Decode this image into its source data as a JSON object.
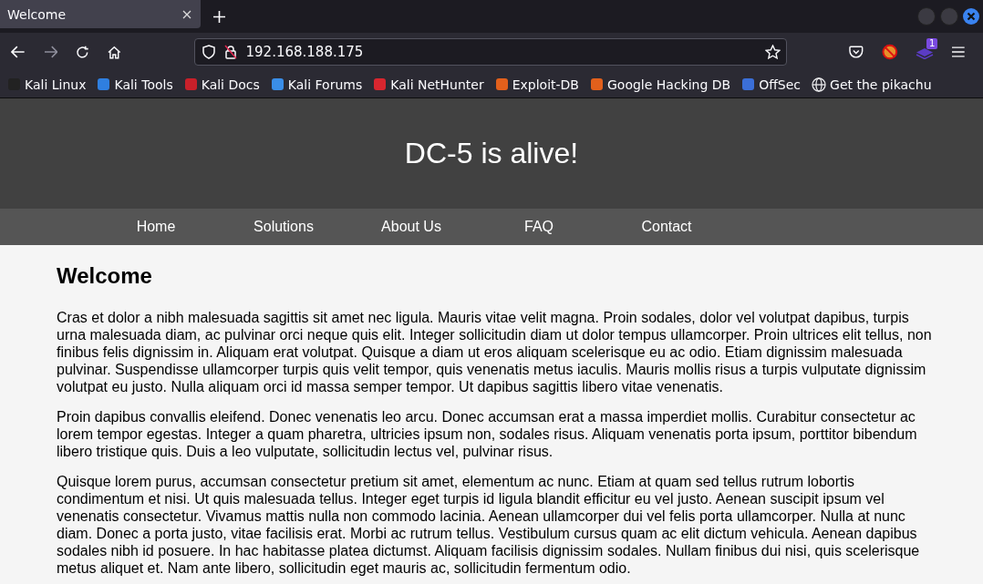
{
  "browser": {
    "tabs": [
      {
        "title": "Welcome",
        "selected": true
      }
    ],
    "url": "192.168.188.175",
    "extension_badge": "1",
    "bookmarks": [
      {
        "label": "Kali Linux",
        "kind": "favicon",
        "color": "#222222"
      },
      {
        "label": "Kali Tools",
        "kind": "favicon",
        "color": "#2f7fe0"
      },
      {
        "label": "Kali Docs",
        "kind": "favicon",
        "color": "#c8202a"
      },
      {
        "label": "Kali Forums",
        "kind": "favicon",
        "color": "#3a8ee8"
      },
      {
        "label": "Kali NetHunter",
        "kind": "favicon",
        "color": "#d8262f"
      },
      {
        "label": "Exploit-DB",
        "kind": "favicon",
        "color": "#e2601c"
      },
      {
        "label": "Google Hacking DB",
        "kind": "favicon",
        "color": "#e2601c"
      },
      {
        "label": "OffSec",
        "kind": "favicon",
        "color": "#3b6fd8"
      },
      {
        "label": "Get the pikachu",
        "kind": "globe",
        "color": "#e8e8ea"
      }
    ]
  },
  "page": {
    "site_title": "DC-5 is alive!",
    "nav": [
      "Home",
      "Solutions",
      "About Us",
      "FAQ",
      "Contact"
    ],
    "heading": "Welcome",
    "paragraphs": [
      "Cras et dolor a nibh malesuada sagittis sit amet nec ligula. Mauris vitae velit magna. Proin sodales, dolor vel volutpat dapibus, turpis urna malesuada diam, ac pulvinar orci neque quis elit. Integer sollicitudin diam ut dolor tempus ullamcorper. Proin ultrices elit tellus, non finibus felis dignissim in. Aliquam erat volutpat. Quisque a diam ut eros aliquam scelerisque eu ac odio. Etiam dignissim malesuada pulvinar. Suspendisse ullamcorper turpis quis velit tempor, quis venenatis metus iaculis. Mauris mollis risus a turpis vulputate dignissim volutpat eu justo. Nulla aliquam orci id massa semper tempor. Ut dapibus sagittis libero vitae venenatis.",
      "Proin dapibus convallis eleifend. Donec venenatis leo arcu. Donec accumsan erat a massa imperdiet mollis. Curabitur consectetur ac lorem tempor egestas. Integer a quam pharetra, ultricies ipsum non, sodales risus. Aliquam venenatis porta ipsum, porttitor bibendum libero tristique quis. Duis a leo vulputate, sollicitudin lectus vel, pulvinar risus.",
      "Quisque lorem purus, accumsan consectetur pretium sit amet, elementum ac nunc. Etiam at quam sed tellus rutrum lobortis condimentum et nisi. Ut quis malesuada tellus. Integer eget turpis id ligula blandit efficitur eu vel justo. Aenean suscipit ipsum vel venenatis consectetur. Vivamus mattis nulla non commodo lacinia. Aenean ullamcorper dui vel felis porta ullamcorper. Nulla at nunc diam. Donec a porta justo, vitae facilisis erat. Morbi ac rutrum tellus. Vestibulum cursus quam ac elit dictum vehicula. Aenean dapibus sodales nibh id posuere. In hac habitasse platea dictumst. Aliquam facilisis dignissim sodales. Nullam finibus dui nisi, quis scelerisque metus aliquet et. Nam ante libero, sollicitudin eget mauris ac, sollicitudin fermentum odio."
    ]
  }
}
